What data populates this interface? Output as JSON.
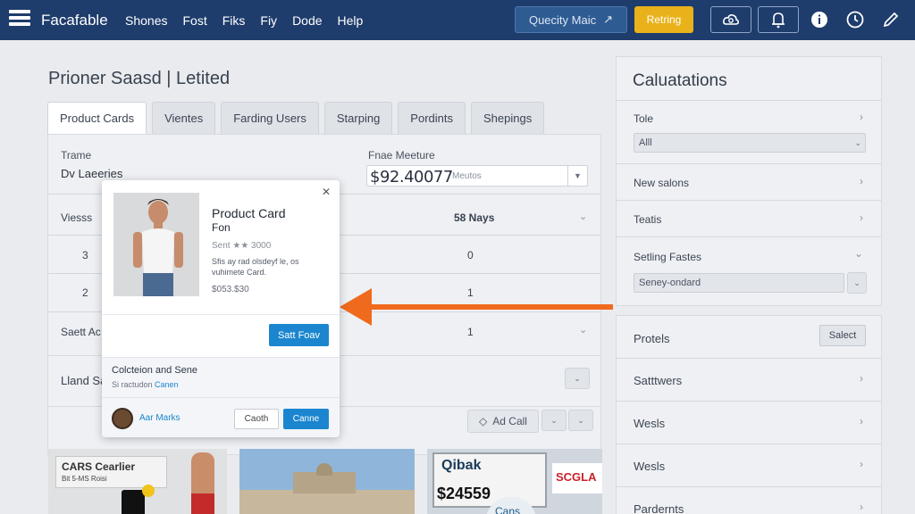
{
  "topbar": {
    "app_title": "Facafable",
    "menu": [
      "Shones",
      "Fost",
      "Fiks",
      "Fiy",
      "Dode",
      "Help"
    ],
    "quick_button": "Quecity Maic",
    "action_button": "Retring",
    "accent": "#1e3c6c",
    "highlight": "#e9b21a"
  },
  "main": {
    "page_title": "Prioner Saasd | Letited",
    "tabs": [
      "Product Cards",
      "Vientes",
      "Farding Users",
      "Starping",
      "Pordints",
      "Shepings"
    ],
    "active_tab": "Product Cards",
    "fields": {
      "frame_label": "Trame",
      "frame_value": "Dv Laeeries",
      "measure_label": "Fnae Meeture",
      "measure_value": "$92.40077",
      "measure_unit": "Meutos"
    },
    "table": {
      "header_left": "Viesss",
      "header_right": "58 Nays",
      "rows": [
        {
          "left": "3",
          "right": "0"
        },
        {
          "left": "2",
          "right": "1"
        },
        {
          "left": "Saett Ac",
          "right": "1"
        }
      ]
    },
    "lower_row_label": "Lland Sa",
    "add_button": "Ad Call"
  },
  "popup": {
    "title": "Product Card",
    "subtitle": "Fon",
    "rating": "Sent ★★ 3000",
    "description": "Sfis ay rad olsdeyf le, os vuhimete Card.",
    "price": "$053.$30",
    "save_button": "Satt Foav",
    "footer_title": "Colcteion and Sene",
    "footer_sub_prefix": "Si ractudon",
    "footer_sub_link": "Canen",
    "user_name": "Aar Marks",
    "cancel_button": "Caoth",
    "confirm_button": "Canne"
  },
  "thumbnails": {
    "t1_line1": "CARS Cearlier",
    "t1_line2": "Bit 5-MS Roisi",
    "t3_line1": "Qibak",
    "t3_line2": "$24559",
    "t3_line3": "Cans",
    "t3_brand": "SCGLA"
  },
  "sidebar": {
    "title": "Caluatations",
    "tole_label": "Tole",
    "tole_select": "Alll",
    "items_top": [
      "New salons",
      "Teatis",
      "Setling Fastes"
    ],
    "sort_select": "Seney-ondard",
    "protels_label": "Protels",
    "select_button": "Salect",
    "items_bottom": [
      "Satttwers",
      "Wesls",
      "Wesls",
      "Pardernts"
    ]
  },
  "annotation": {
    "arrow_color": "#f06a1d"
  }
}
